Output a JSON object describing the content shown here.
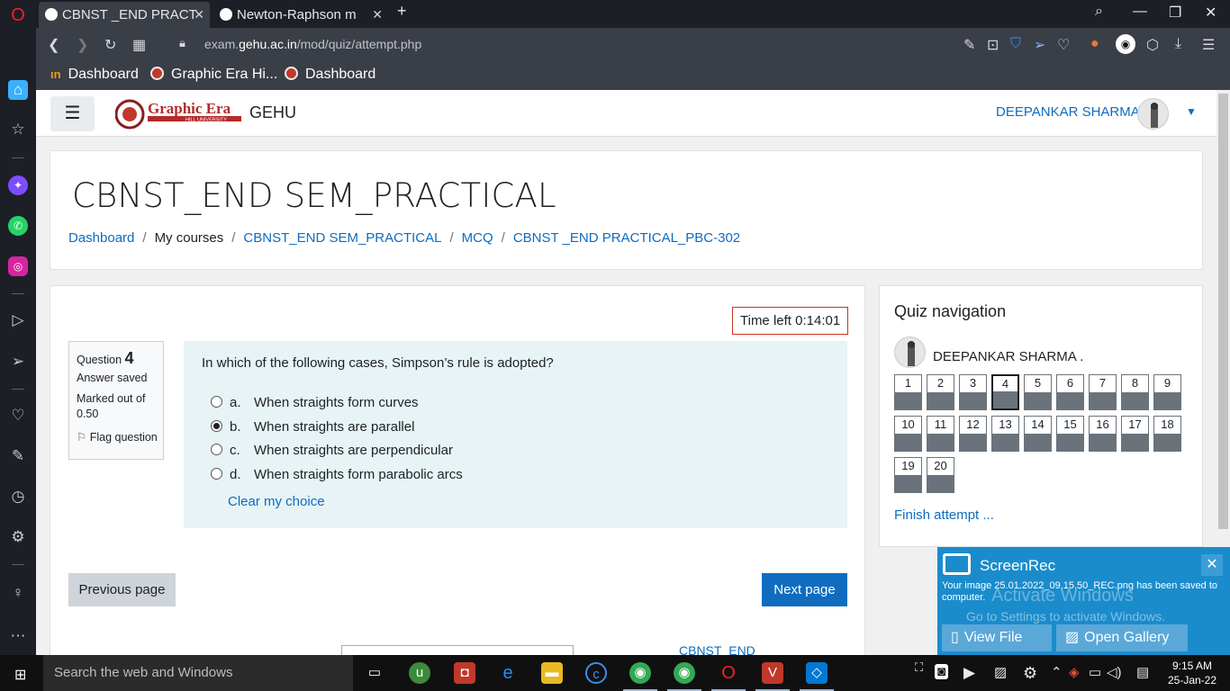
{
  "browser": {
    "tabs": [
      {
        "title": "CBNST _END PRACT",
        "active": true
      },
      {
        "title": "Newton-Raphson m",
        "active": false
      }
    ],
    "url_prefix": "exam.",
    "url_domain": "gehu.ac.in",
    "url_path": "/mod/quiz/attempt.php",
    "bookmarks": [
      "Dashboard",
      "Graphic Era Hi...",
      "Dashboard"
    ]
  },
  "site": {
    "logo_text": "Graphic Era",
    "logo_sub": "HILL UNIVERSITY",
    "name": "GEHU",
    "user": "DEEPANKAR SHARMA ."
  },
  "course": {
    "title": "CBNST_END SEM_PRACTICAL",
    "breadcrumb": [
      "Dashboard",
      "My courses",
      "CBNST_END SEM_PRACTICAL",
      "MCQ",
      "CBNST _END PRACTICAL_PBC-302"
    ]
  },
  "quiz": {
    "time_left": "Time left 0:14:01",
    "question_label": "Question",
    "question_number": "4",
    "status": "Answer saved",
    "marked_out_of": "Marked out of",
    "marks": "0.50",
    "flag": "Flag question",
    "question_text": "In which of the following cases, Simpson’s rule is adopted?",
    "options": [
      {
        "letter": "a.",
        "text": "When straights form curves",
        "selected": false
      },
      {
        "letter": "b.",
        "text": "When straights are parallel",
        "selected": true
      },
      {
        "letter": "c.",
        "text": "When straights are perpendicular",
        "selected": false
      },
      {
        "letter": "d.",
        "text": "When straights form parabolic arcs",
        "selected": false
      }
    ],
    "clear_choice": "Clear my choice",
    "previous": "Previous page",
    "next": "Next page",
    "bottom_link": "CBNST_END"
  },
  "quiz_nav": {
    "title": "Quiz navigation",
    "user": "DEEPANKAR SHARMA .",
    "questions": [
      "1",
      "2",
      "3",
      "4",
      "5",
      "6",
      "7",
      "8",
      "9",
      "10",
      "11",
      "12",
      "13",
      "14",
      "15",
      "16",
      "17",
      "18",
      "19",
      "20"
    ],
    "current": "4",
    "finish": "Finish attempt ..."
  },
  "screenrec": {
    "title": "ScreenRec",
    "message": "Your image 25.01.2022_09.15.50_REC.png has been saved to computer.",
    "watermark_1": "Activate Windows",
    "watermark_2": "Go to Settings to activate Windows.",
    "view_file": "View File",
    "open_gallery": "Open Gallery"
  },
  "taskbar": {
    "search_placeholder": "Search the web and Windows",
    "time": "9:15 AM",
    "date": "25-Jan-22"
  },
  "colors": {
    "link": "#0f6cbf",
    "primary_button": "#0f6cbf",
    "timer_border": "#ca3120",
    "question_bg": "#e7f3f5",
    "screenrec_bg": "#1a8ccc"
  }
}
